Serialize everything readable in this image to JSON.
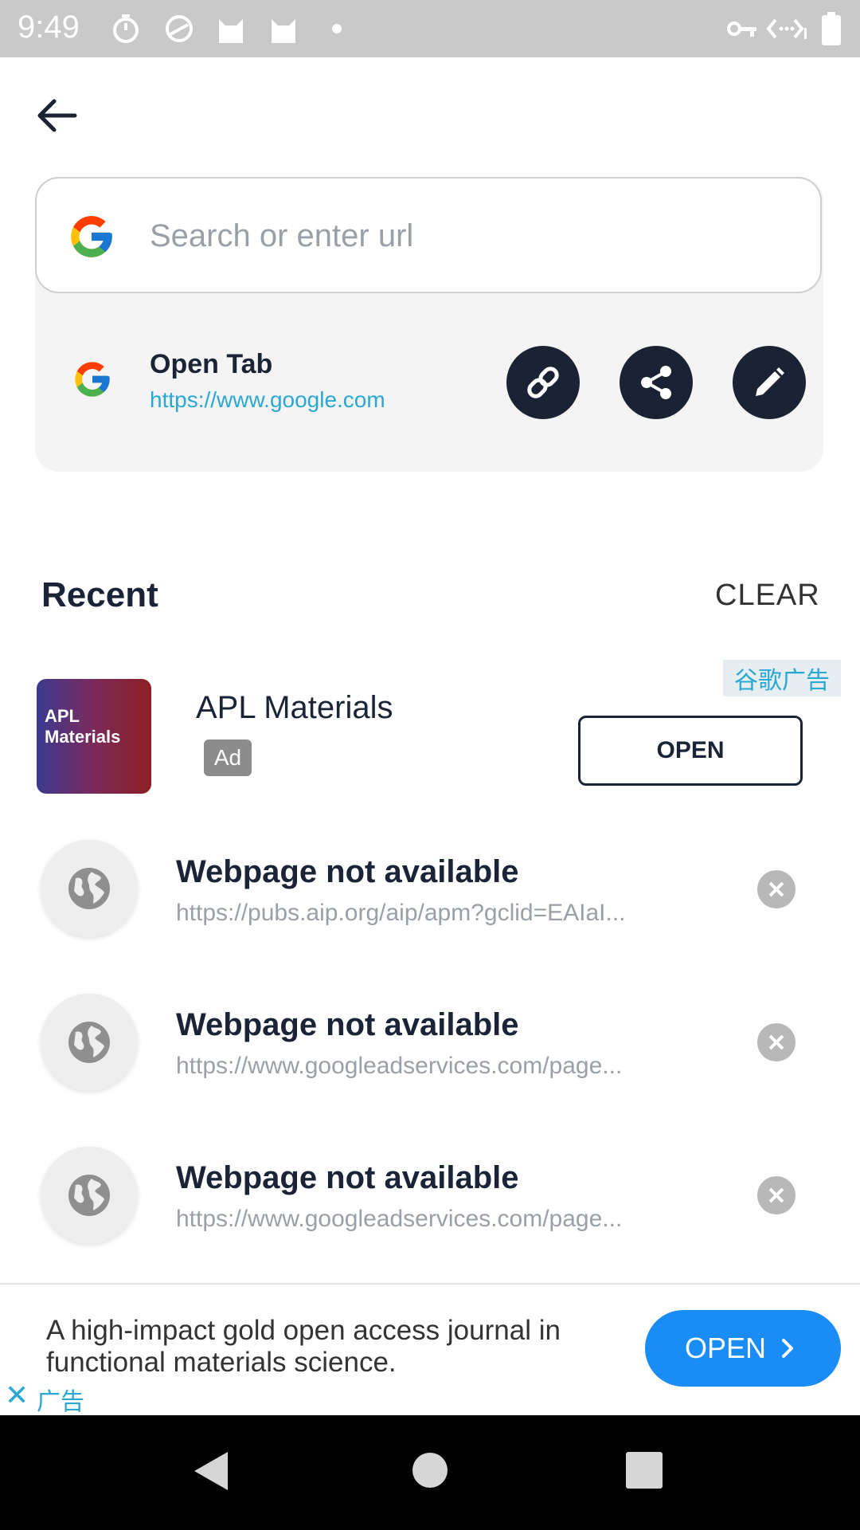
{
  "status_bar": {
    "time": "9:49",
    "icons": [
      "timer-icon",
      "no-disturb-icon",
      "cat-icon",
      "cat-icon",
      "dot-icon",
      "vpn-key-icon",
      "data-icon",
      "battery-icon"
    ]
  },
  "search": {
    "placeholder": "Search or enter url"
  },
  "open_tab": {
    "title": "Open Tab",
    "url": "https://www.google.com",
    "actions": [
      "link-icon",
      "share-icon",
      "edit-icon"
    ]
  },
  "recent": {
    "title": "Recent",
    "clear_label": "CLEAR"
  },
  "ad_row": {
    "thumb_text_line1": "APL",
    "thumb_text_line2": "Materials",
    "name": "APL Materials",
    "badge": "Ad",
    "label_cn": "谷歌广告",
    "open_label": "OPEN"
  },
  "history": [
    {
      "title": "Webpage not available",
      "url": "https://pubs.aip.org/aip/apm?gclid=EAIaI..."
    },
    {
      "title": "Webpage not available",
      "url": "https://www.googleadservices.com/page..."
    },
    {
      "title": "Webpage not available",
      "url": "https://www.googleadservices.com/page..."
    }
  ],
  "bottom_ad": {
    "text": "A high-impact gold open access journal in functional materials science.",
    "open_label": "OPEN",
    "close_symbol": "✕",
    "label_cn": "广告"
  },
  "colors": {
    "dark": "#1a2233",
    "accent_blue": "#1a8cf5",
    "link": "#2ba7d3"
  }
}
